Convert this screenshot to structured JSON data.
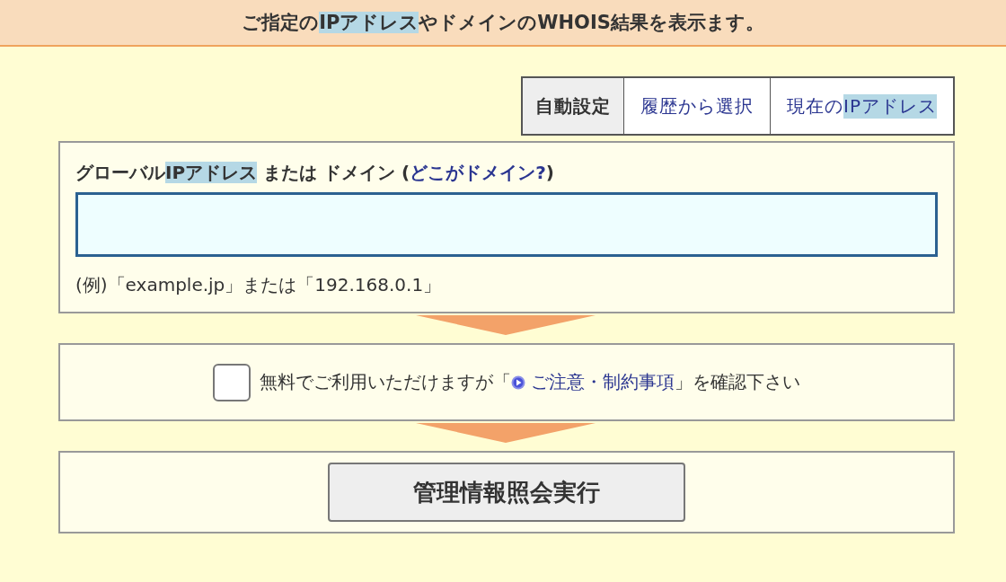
{
  "header": {
    "segments": [
      {
        "text": "ご指定の",
        "highlighted": false
      },
      {
        "text": "IPアドレス",
        "highlighted": true
      },
      {
        "text": "やドメインのWHOIS結果を表示ます。",
        "highlighted": false
      }
    ]
  },
  "tabs": [
    {
      "segments": [
        {
          "text": "自動設定",
          "highlighted": false
        }
      ],
      "selected": true
    },
    {
      "segments": [
        {
          "text": "履歴から選択",
          "highlighted": false
        }
      ],
      "selected": false
    },
    {
      "segments": [
        {
          "text": "現在の",
          "highlighted": false
        },
        {
          "text": "IPアドレス",
          "highlighted": true
        }
      ],
      "selected": false
    }
  ],
  "query_field": {
    "label_segments": [
      {
        "text": "グローバル",
        "highlighted": false
      },
      {
        "text": "IPアドレス",
        "highlighted": true
      },
      {
        "text": " または ドメイン (",
        "highlighted": false
      }
    ],
    "help_link": "どこがドメイン?",
    "label_end": ")",
    "example": "(例)「example.jp」または「192.168.0.1」"
  },
  "agreement": {
    "checked": false,
    "text_before": "無料でご利用いただけますが「",
    "link": "ご注意・制約事項",
    "text_after": "」を確認下さい"
  },
  "submit_button": "管理情報照会実行"
}
